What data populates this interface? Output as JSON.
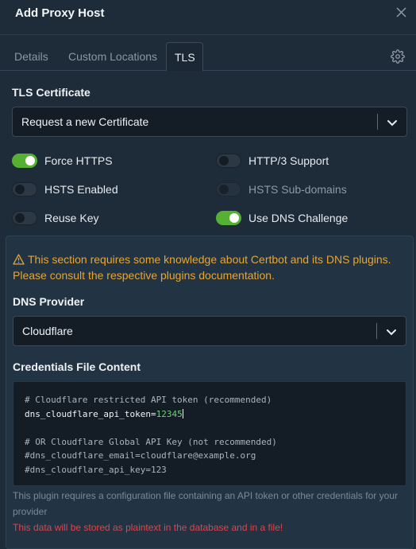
{
  "dialog": {
    "title": "Add Proxy Host"
  },
  "tabs": [
    {
      "label": "Details"
    },
    {
      "label": "Custom Locations"
    },
    {
      "label": "TLS"
    }
  ],
  "tls": {
    "certificate_label": "TLS Certificate",
    "certificate_value": "Request a new Certificate",
    "toggles": {
      "force_https": {
        "label": "Force HTTPS",
        "on": true
      },
      "http3": {
        "label": "HTTP/3 Support",
        "on": false
      },
      "hsts": {
        "label": "HSTS Enabled",
        "on": false
      },
      "hsts_sub": {
        "label": "HSTS Sub-domains",
        "on": false,
        "disabled": true
      },
      "reuse_key": {
        "label": "Reuse Key",
        "on": false
      },
      "dns_challenge": {
        "label": "Use DNS Challenge",
        "on": true
      }
    }
  },
  "dns": {
    "warning": "This section requires some knowledge about Certbot and its DNS plugins. Please consult the respective plugins documentation.",
    "provider_label": "DNS Provider",
    "provider_value": "Cloudflare",
    "credentials_label": "Credentials File Content",
    "credentials": {
      "line1": "# Cloudflare restricted API token (recommended)",
      "line2_key": "dns_cloudflare_api_token=",
      "line2_value": "12345",
      "line4": "# OR Cloudflare Global API Key (not recommended)",
      "line5": "#dns_cloudflare_email=cloudflare@example.org",
      "line6": "#dns_cloudflare_api_key=123"
    },
    "help": "This plugin requires a configuration file containing an API token or other credentials for your provider",
    "danger": "This data will be stored as plaintext in the database and in a file!"
  },
  "colors": {
    "accent_green": "#56b033",
    "warning": "#e8a530",
    "danger": "#e0434a"
  },
  "icons": [
    "close-icon",
    "gear-icon",
    "chevron-down-icon",
    "warning-triangle-icon"
  ]
}
